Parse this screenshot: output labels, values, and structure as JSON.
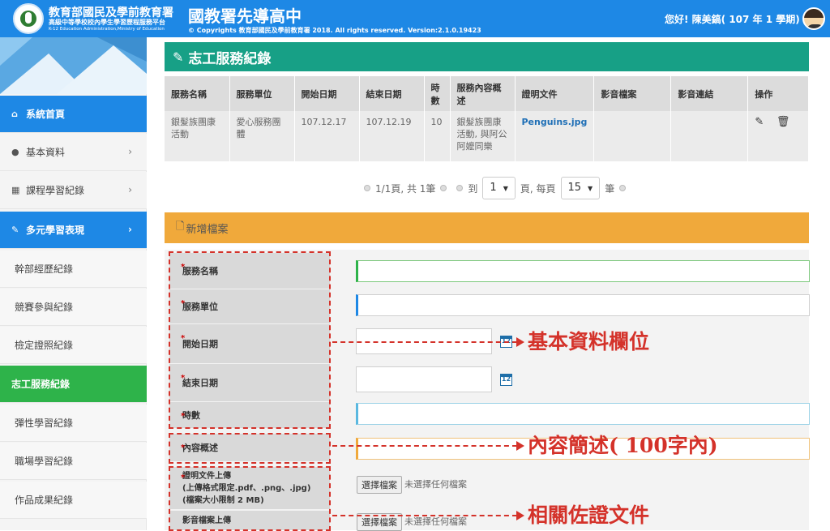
{
  "header": {
    "org_name": "教育部國民及學前教育署",
    "platform_name": "高級中等學校校內學生學習歷程服務平台",
    "org_name_en": "K-12 Education Administration,Ministry of Education",
    "school_name": "國教署先導高中",
    "copyright": "© Copyrights 教育部國民及學前教育署 2018. All rights reserved. Version:2.1.0.19423",
    "greeting": "您好! 陳美鎬( 107 年 1 學期)"
  },
  "sidebar": {
    "items": [
      {
        "label": "系統首頁",
        "icon": "home-icon"
      },
      {
        "label": "基本資料",
        "icon": "user-icon"
      },
      {
        "label": "課程學習紀錄",
        "icon": "book-icon"
      },
      {
        "label": "多元學習表現",
        "icon": "brush-icon"
      },
      {
        "label": "幹部經歷紀錄"
      },
      {
        "label": "競賽參與紀錄"
      },
      {
        "label": "檢定證照紀錄"
      },
      {
        "label": "志工服務紀錄"
      },
      {
        "label": "彈性學習紀錄"
      },
      {
        "label": "職場學習紀錄"
      },
      {
        "label": "作品成果紀錄"
      }
    ]
  },
  "page": {
    "title": "志工服務紀錄"
  },
  "table": {
    "columns": [
      "服務名稱",
      "服務單位",
      "開始日期",
      "結束日期",
      "時數",
      "服務內容概述",
      "證明文件",
      "影音檔案",
      "影音連結",
      "操作"
    ],
    "rows": [
      {
        "name": "銀髮族團康活動",
        "unit": "愛心服務團體",
        "start": "107.12.17",
        "end": "107.12.19",
        "hours": "10",
        "summary": "銀髮族團康活動, 與阿公阿嬤同樂",
        "proof": "Penguins.jpg",
        "media": "",
        "link": ""
      }
    ]
  },
  "pager": {
    "info": "1/1頁, 共 1筆",
    "goto_label": "到",
    "page_value": "1",
    "per_page_label": "頁, 每頁",
    "per_page_value": "15",
    "unit_label": "筆"
  },
  "form": {
    "section_title": "新增檔案",
    "required_mark": "*",
    "labels": {
      "name": "服務名稱",
      "unit": "服務單位",
      "start": "開始日期",
      "end": "結束日期",
      "hours": "時數",
      "summary": "內容概述",
      "proof_upload": "證明文件上傳",
      "proof_format": "(上傳格式限定.pdf、.png、.jpg)",
      "proof_size": "(檔案大小限制 2 MB)",
      "media_upload": "影音檔案上傳"
    },
    "values": {
      "name": "",
      "unit": "",
      "start": "",
      "end": "",
      "hours": "",
      "summary": ""
    },
    "file_button": "選擇檔案",
    "no_file": "未選擇任何檔案"
  },
  "annotations": {
    "basic": "基本資料欄位",
    "summary": "內容簡述( 100字內)",
    "docs": "相關佐證文件"
  },
  "colors": {
    "header_blue": "#1e88e5",
    "title_teal": "#17a086",
    "section_orange": "#f0a93b",
    "active_green": "#2eb34a",
    "annotation_red": "#d4322a"
  }
}
